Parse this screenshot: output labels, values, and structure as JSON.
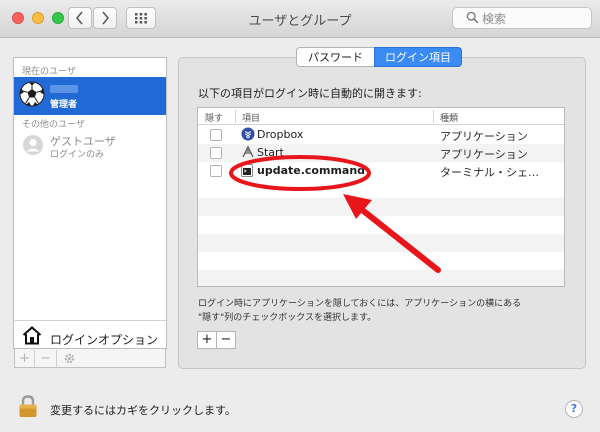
{
  "window": {
    "title": "ユーザとグループ"
  },
  "search": {
    "placeholder": "検索"
  },
  "sidebar": {
    "section_current": "現在のユーザ",
    "current_user": {
      "role": "管理者"
    },
    "section_other": "その他のユーザ",
    "guest": {
      "name": "ゲストユーザ",
      "subtitle": "ログインのみ"
    },
    "login_options": "ログインオプション",
    "toolbar": {
      "add": "+",
      "remove": "−"
    }
  },
  "tabs": [
    {
      "label": "パスワード",
      "selected": false
    },
    {
      "label": "ログイン項目",
      "selected": true
    }
  ],
  "main": {
    "heading": "以下の項目がログイン時に自動的に開きます:",
    "table": {
      "columns": [
        "隠す",
        "項目",
        "種類"
      ],
      "rows": [
        {
          "hide": false,
          "icon": "dropbox-icon",
          "item": "Dropbox",
          "kind": "アプリケーション"
        },
        {
          "hide": false,
          "icon": "start-app-icon",
          "item": "Start",
          "kind": "アプリケーション"
        },
        {
          "hide": false,
          "icon": "terminal-icon",
          "item": "update.command",
          "kind": "ターミナル・シェ…"
        }
      ]
    },
    "note_line1": "ログイン時にアプリケーションを隠しておくには、アプリケーションの横にある",
    "note_line2": "\"隠す\"列のチェックボックスを選択します。",
    "add_button": "+",
    "remove_button": "−"
  },
  "bottom": {
    "lock_text": "変更するにはカギをクリックします。",
    "help": "?"
  },
  "colors": {
    "accent": "#3b8bf5",
    "selection": "#2169d4",
    "annotation": "#e8161b"
  }
}
